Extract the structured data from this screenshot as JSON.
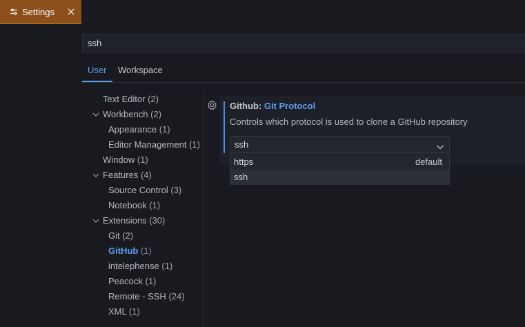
{
  "tab": {
    "label": "Settings"
  },
  "search": {
    "value": "ssh"
  },
  "scope_tabs": {
    "user": "User",
    "workspace": "Workspace"
  },
  "toc": {
    "text_editor": "Text Editor",
    "text_editor_count": "(2)",
    "workbench": "Workbench",
    "workbench_count": "(2)",
    "appearance": "Appearance",
    "appearance_count": "(1)",
    "editor_management": "Editor Management",
    "editor_management_count": "(1)",
    "window": "Window",
    "window_count": "(1)",
    "features": "Features",
    "features_count": "(4)",
    "source_control": "Source Control",
    "source_control_count": "(3)",
    "notebook": "Notebook",
    "notebook_count": "(1)",
    "extensions": "Extensions",
    "extensions_count": "(30)",
    "git": "Git",
    "git_count": "(2)",
    "github": "GitHub",
    "github_count": "(1)",
    "intelephense": "intelephense",
    "intelephense_count": "(1)",
    "peacock": "Peacock",
    "peacock_count": "(1)",
    "remote_ssh": "Remote - SSH",
    "remote_ssh_count": "(24)",
    "xml": "XML",
    "xml_count": "(1)"
  },
  "setting": {
    "category": "Github: ",
    "name": "Git Protocol",
    "description": "Controls which protocol is used to clone a GitHub repository",
    "value": "ssh",
    "options": [
      {
        "label": "https",
        "tag": "default"
      },
      {
        "label": "ssh",
        "tag": ""
      }
    ]
  },
  "colors": {
    "accent": "#5d9ef0",
    "tab_background": "#8a4f1b",
    "editor_background": "#181a1f"
  },
  "icons": [
    "settings-sliders-icon",
    "close-icon",
    "chevron-down-icon",
    "gear-icon"
  ]
}
